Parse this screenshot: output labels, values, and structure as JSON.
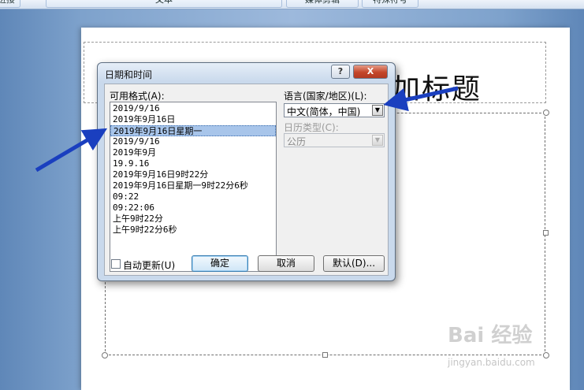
{
  "ribbon": {
    "tabs": [
      "进接",
      "文本",
      "媒体剪辑",
      "特殊符号"
    ]
  },
  "slide": {
    "title_text": "单击此处添加标题"
  },
  "dialog": {
    "title": "日期和时间",
    "help_glyph": "?",
    "close_glyph": "X",
    "available_formats_label": "可用格式(A):",
    "formats": [
      "2019/9/16",
      "2019年9月16日",
      "2019年9月16日星期一",
      "2019/9/16",
      "2019年9月",
      "19.9.16",
      "2019年9月16日9时22分",
      "2019年9月16日星期一9时22分6秒",
      "09:22",
      "09:22:06",
      "上午9时22分",
      "上午9时22分6秒"
    ],
    "selected_format": "2019年9月16日星期一",
    "language_label": "语言(国家/地区)(L):",
    "language_value": "中文(简体，中国)",
    "calendar_type_label": "日历类型(C):",
    "calendar_type_value": "公历",
    "auto_update_label": "自动更新(U)",
    "auto_update_checked": false,
    "ok_label": "确定",
    "cancel_label": "取消",
    "default_label": "默认(D)..."
  },
  "watermark": {
    "text": "Bai 经验",
    "sub": "jingyan.baidu.com"
  },
  "colors": {
    "annotation_arrow": "#1a3fbf",
    "selection": "#a8c5ea",
    "close_button": "#c4462a"
  }
}
